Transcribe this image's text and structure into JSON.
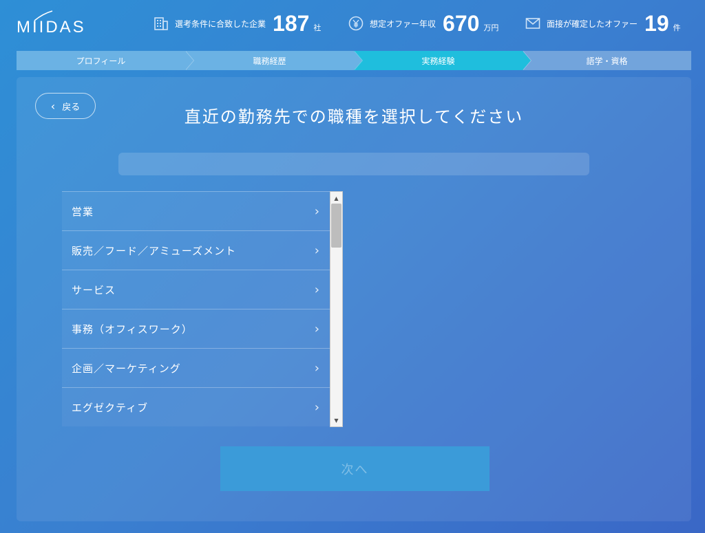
{
  "header": {
    "logo": "MIIDAS",
    "stats": [
      {
        "icon": "building-icon",
        "label": "選考条件に合致した企業",
        "value": "187",
        "unit": "社"
      },
      {
        "icon": "yen-icon",
        "label": "想定オファー年収",
        "value": "670",
        "unit": "万円"
      },
      {
        "icon": "mail-icon",
        "label": "面接が確定したオファー",
        "value": "19",
        "unit": "件"
      }
    ]
  },
  "steps": [
    {
      "label": "プロフィール",
      "state": "done"
    },
    {
      "label": "職務経歴",
      "state": "done"
    },
    {
      "label": "実務経験",
      "state": "active"
    },
    {
      "label": "語学・資格",
      "state": "todo"
    }
  ],
  "back_label": "戻る",
  "title": "直近の勤務先での職種を選択してください",
  "categories": [
    "営業",
    "販売／フード／アミューズメント",
    "サービス",
    "事務（オフィスワーク）",
    "企画／マーケティング",
    "エグゼクティブ"
  ],
  "next_label": "次へ",
  "colors": {
    "accent": "#1fbedd",
    "step_done": "#6bb2e4",
    "step_todo": "#72a4dc",
    "next_button": "#3b9bd9"
  }
}
